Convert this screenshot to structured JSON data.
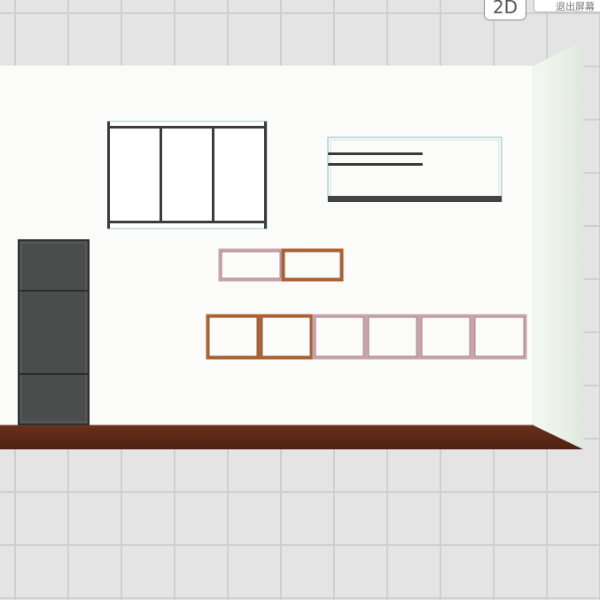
{
  "toolbar": {
    "view_toggle_label": "2D",
    "exit_fullscreen_label": "退出屏幕"
  },
  "colors": {
    "background": "#e4e4e4",
    "grid_line": "#cfcfcf",
    "back_wall": "#fbfcf9",
    "side_wall": "#e8efe6",
    "floor": "#5a2a17",
    "dark_cabinet": "#4b4c4c",
    "orange_frame": "#b0612e",
    "pink_frame": "#c9a3ad",
    "glass_edge": "#9fc3d0"
  },
  "scene": {
    "objects": [
      {
        "name": "wall-cabinet-three-door",
        "doors": 3
      },
      {
        "name": "wall-shelf-glass",
        "shelves": 2
      },
      {
        "name": "cube-shelf-upper",
        "cubes": 2,
        "frame": "orange"
      },
      {
        "name": "cube-shelf-lower-orange",
        "cubes": 2,
        "frame": "orange"
      },
      {
        "name": "cube-shelf-lower-pink",
        "cubes": 4,
        "frame": "pink"
      },
      {
        "name": "tall-cabinet",
        "sections": 3
      }
    ]
  }
}
